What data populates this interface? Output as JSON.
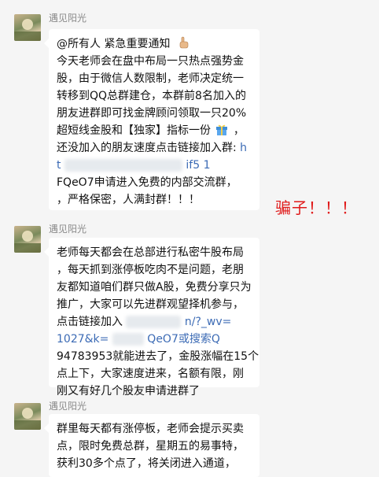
{
  "messages": [
    {
      "sender": "遇见阳光",
      "lines": [
        {
          "text": "@所有人   紧急重要通知",
          "icon": "pointing-hand-icon"
        },
        {
          "text": "今天老师会在盘中布局一只热点强势金"
        },
        {
          "text": "股，由于微信人数限制，老师决定统一"
        },
        {
          "text": "转移到QQ总群建仓，本群前8名加入的"
        },
        {
          "text": "朋友进群即可找金牌顾问领取一只20%"
        },
        {
          "text": "超短线金股和【独家】指标一份",
          "icon": "gift-icon",
          "suffix": "，"
        },
        {
          "text": "还没加入的朋友速度点击链接加入群:"
        },
        {
          "text": "FQeO7申请进入免费的内部交流群，"
        },
        {
          "text": "，严格保密，人满封群！！！"
        }
      ],
      "link_fragments": [
        "h",
        "t",
        "if5",
        "1"
      ]
    },
    {
      "sender": "遇见阳光",
      "lines": [
        {
          "text": "老师每天都会在总部进行私密牛股布局"
        },
        {
          "text": "，每天抓到涨停板吃肉不是问题，老朋"
        },
        {
          "text": "友都知道咱们群只做A股，免费分享只为"
        },
        {
          "text": "推广，大家可以先进群观望择机参与，"
        },
        {
          "text": "点击链接加入"
        },
        {
          "text": "1027&k="
        },
        {
          "text": "94783953就能进去了，金股涨幅在15个"
        },
        {
          "text": "点上下，大家速度进来，名额有限，刚"
        },
        {
          "text": "刚又有好几个股友申请进群了"
        }
      ],
      "link_fragments": [
        "n/?_wv=",
        "QeO7或搜索Q"
      ]
    },
    {
      "sender": "遇见阳光",
      "lines": [
        {
          "text": "群里每天都有涨停板，老师会提示买卖"
        },
        {
          "text": "点，限时免费总群，星期五的易事特，"
        },
        {
          "text": "获利30多个点了，将关闭进入通道，"
        }
      ]
    }
  ],
  "annotation": {
    "text": "骗子！！！",
    "color": "#e01a1a"
  }
}
